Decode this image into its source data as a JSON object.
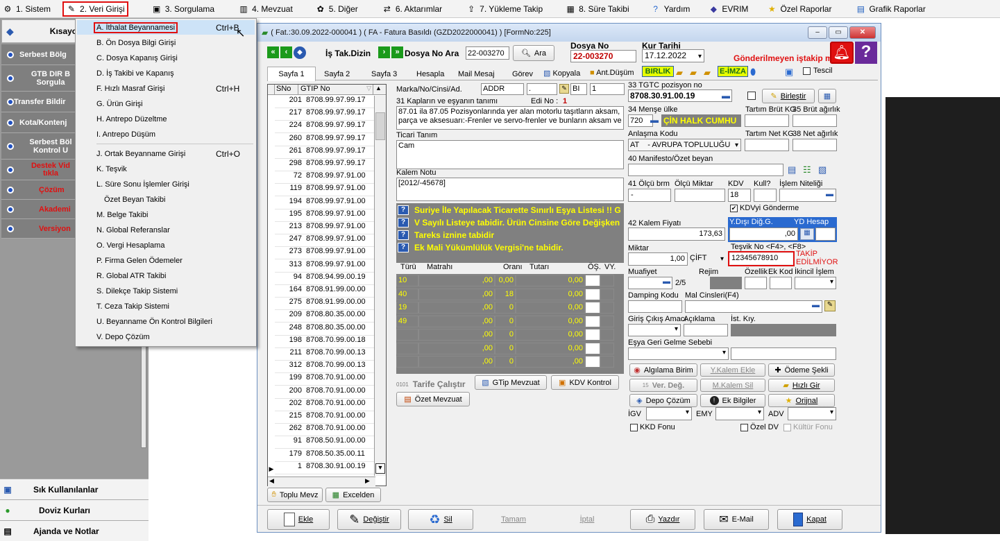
{
  "menubar": {
    "items": [
      {
        "label": "1. Sistem",
        "icon": "system-icon"
      },
      {
        "label": "2. Veri Girişi",
        "icon": "data-entry-icon"
      },
      {
        "label": "3. Sorgulama",
        "icon": "query-icon"
      },
      {
        "label": "4. Mevzuat",
        "icon": "books-icon"
      },
      {
        "label": "5. Diğer",
        "icon": "other-icon"
      },
      {
        "label": "6. Aktarımlar",
        "icon": "transfer-icon"
      },
      {
        "label": "7. Yükleme Takip",
        "icon": "upload-icon"
      },
      {
        "label": "8. Süre Takibi",
        "icon": "calendar-icon"
      },
      {
        "label": "Yardım",
        "icon": "help-icon"
      },
      {
        "label": "EVRIM",
        "icon": "evrim-icon"
      },
      {
        "label": "Özel Raporlar",
        "icon": "star-icon"
      },
      {
        "label": "Grafik Raporlar",
        "icon": "chart-icon"
      }
    ]
  },
  "left_panel": {
    "header": "Kısayo",
    "items": [
      {
        "label": "Serbest Bölg",
        "red": false
      },
      {
        "label": "GTB DIR B\nSorgula",
        "red": false
      },
      {
        "label": "Transfer Bildir",
        "red": false
      },
      {
        "label": "Kota/Kontenj",
        "red": false
      },
      {
        "label": "Serbest Böl\nKontrol U",
        "red": false
      },
      {
        "label": "Destek Vid\ntıkla",
        "red": true
      },
      {
        "label": "Çözüm",
        "red": true
      },
      {
        "label": "Akademi",
        "red": true
      },
      {
        "label": "Versiyon",
        "red": true
      }
    ],
    "bottom": [
      {
        "label": "Sık Kullanılanlar",
        "icon": "favorites-icon"
      },
      {
        "label": "Doviz Kurları",
        "icon": "currency-icon"
      },
      {
        "label": "Ajanda ve Notlar",
        "icon": "notes-icon"
      }
    ]
  },
  "dropdown": {
    "items": [
      {
        "label": "A.  İthalat Beyannamesi",
        "shortcut": "Ctrl+B",
        "highlight": true
      },
      {
        "label": "B.  Ön Dosya Bilgi Girişi",
        "shortcut": ""
      },
      {
        "label": "C.  Dosya Kapanış Girişi",
        "shortcut": ""
      },
      {
        "label": "D.  İş Takibi ve Kapanış",
        "shortcut": ""
      },
      {
        "label": "F.  Hızlı Masraf Girişi",
        "shortcut": "Ctrl+H"
      },
      {
        "label": "G.  Ürün Girişi",
        "shortcut": ""
      },
      {
        "label": "H.  Antrepo Düzeltme",
        "shortcut": ""
      },
      {
        "label": "I.  Antrepo Düşüm",
        "shortcut": ""
      },
      {
        "label": "J.  Ortak Beyanname Girişi",
        "shortcut": "Ctrl+O"
      },
      {
        "label": "K.  Teşvik",
        "shortcut": ""
      },
      {
        "label": "L.  Süre Sonu İşlemler Girişi",
        "shortcut": ""
      },
      {
        "label": "Özet Beyan Takibi",
        "shortcut": ""
      },
      {
        "label": "M.  Belge Takibi",
        "shortcut": ""
      },
      {
        "label": "N.  Global Referanslar",
        "shortcut": ""
      },
      {
        "label": "O. Vergi Hesaplama",
        "shortcut": ""
      },
      {
        "label": "P. Firma Gelen Ödemeler",
        "shortcut": ""
      },
      {
        "label": "R. Global ATR Takibi",
        "shortcut": ""
      },
      {
        "label": "S. Dilekçe Takip Sistemi",
        "shortcut": ""
      },
      {
        "label": "T. Ceza Takip Sistemi",
        "shortcut": ""
      },
      {
        "label": "U. Beyanname Ön Kontrol Bilgileri",
        "shortcut": ""
      },
      {
        "label": "V. Depo Çözüm",
        "shortcut": ""
      }
    ]
  },
  "window": {
    "title": "( Fat.:30.09.2022-000041 ) ( FA  - Fatura Basıldı (GZD2022000041) ) [FormNo:225]",
    "is_takip_label": "İş Tak.Dizin",
    "dosya_ara_label": "Dosya No Ara",
    "dosya_ara_value": "22-003270",
    "ara_button": "Ara",
    "dosya_no_label": "Dosya No",
    "dosya_no_value": "22-003270",
    "kur_tarihi_label": "Kur Tarihi",
    "kur_tarihi_value": "17.12.2022",
    "gonderilmeyen": "Gönderilmeyen iştakip m",
    "tabs": [
      "Sayfa 1",
      "Sayfa 2",
      "Sayfa 3",
      "Hesapla",
      "Mail Mesaj",
      "Görev",
      "Kopyala",
      "Ant.Düşüm"
    ],
    "birlik": "BIRLIK",
    "eimza": "E-İMZA",
    "tescil": "Tescil"
  },
  "gtip_table": {
    "headers": [
      "SNo",
      "GTIP No"
    ],
    "rows": [
      [
        "201",
        "8708.99.97.99.17"
      ],
      [
        "217",
        "8708.99.97.99.17"
      ],
      [
        "224",
        "8708.99.97.99.17"
      ],
      [
        "260",
        "8708.99.97.99.17"
      ],
      [
        "261",
        "8708.99.97.99.17"
      ],
      [
        "298",
        "8708.99.97.99.17"
      ],
      [
        "72",
        "8708.99.97.91.00"
      ],
      [
        "119",
        "8708.99.97.91.00"
      ],
      [
        "194",
        "8708.99.97.91.00"
      ],
      [
        "195",
        "8708.99.97.91.00"
      ],
      [
        "213",
        "8708.99.97.91.00"
      ],
      [
        "247",
        "8708.99.97.91.00"
      ],
      [
        "273",
        "8708.99.97.91.00"
      ],
      [
        "313",
        "8708.99.97.91.00"
      ],
      [
        "94",
        "8708.94.99.00.19"
      ],
      [
        "164",
        "8708.91.99.00.00"
      ],
      [
        "275",
        "8708.91.99.00.00"
      ],
      [
        "209",
        "8708.80.35.00.00"
      ],
      [
        "248",
        "8708.80.35.00.00"
      ],
      [
        "198",
        "8708.70.99.00.18"
      ],
      [
        "211",
        "8708.70.99.00.13"
      ],
      [
        "312",
        "8708.70.99.00.13"
      ],
      [
        "199",
        "8708.70.91.00.00"
      ],
      [
        "200",
        "8708.70.91.00.00"
      ],
      [
        "202",
        "8708.70.91.00.00"
      ],
      [
        "215",
        "8708.70.91.00.00"
      ],
      [
        "262",
        "8708.70.91.00.00"
      ],
      [
        "91",
        "8708.50.91.00.00"
      ],
      [
        "179",
        "8708.50.35.00.11"
      ],
      [
        "1",
        "8708.30.91.00.19"
      ]
    ],
    "toplu_mevz": "Toplu Mevz",
    "excelden": "Excelden"
  },
  "mid": {
    "marka_label": "Marka/No/Cinsi/Ad.",
    "marka_value": "ADDR",
    "bi_value": "BI",
    "one_value": "1",
    "kaplar_label": "31 Kapların ve eşyanın tanımı",
    "edi_no_label": "Edi No :",
    "edi_no_value": "1",
    "description": "87.01 ila 87.05 Pozisyonlarında yer alan motorlu taşıtların aksam, parça ve aksesuarı:-Frenler ve servo-frenler ve bunların aksam ve",
    "ticari_label": "Ticari Tanım",
    "ticari_value": "Cam",
    "kalem_notu_label": "Kalem Notu",
    "kalem_notu_value": "[2012/-45678]",
    "warnings": [
      "Suriye İle Yapılacak Ticarette Sınırlı Eşya Listesi !! G",
      "V Sayılı Listeye tabidir. Ürün Cinsine Göre Değişken",
      "Tareks iznine tabidir",
      "Ek Mali Yükümlülük Vergisi'ne tabidir."
    ],
    "tax_headers": [
      "Türü",
      "Matrahı",
      "Oranı",
      "Tutarı",
      "ÖŞ.",
      "VY."
    ],
    "tax_rows": [
      [
        "10",
        ",00",
        "0,00",
        "0,00"
      ],
      [
        "40",
        ",00",
        "18",
        "0,00"
      ],
      [
        "19",
        ",00",
        "0",
        "0,00"
      ],
      [
        "49",
        ",00",
        "0",
        "0,00"
      ],
      [
        "",
        ",00",
        "0",
        "0,00"
      ],
      [
        "",
        ",00",
        "0",
        "0,00"
      ],
      [
        "",
        ",00",
        "0",
        ",00"
      ]
    ],
    "tarife_calistir": "Tarife Çalıştır",
    "gtip_mevzuat": "GTip Mevzuat",
    "kdv_kontrol": "KDV Kontrol",
    "ozet_mevzuat": "Özet Mevzuat"
  },
  "right": {
    "tgtc_label": "33 TGTC pozisyon no",
    "tgtc_value": "8708.30.91.00.19",
    "birlestir": "Birleştir",
    "mense_label": "34 Menşe ülke",
    "mense_code": "720",
    "mense_name": "ÇİN HALK CUMHU",
    "tartim_brut_label": "Tartım Brüt KG",
    "brut_agirlik_label": "35 Brüt ağırlık",
    "anlasma_label": "Anlaşma Kodu",
    "anlasma_value": "AT    - AVRUPA TOPLULUĞU",
    "tartim_net_label": "Tartım Net KG",
    "net_agirlik_label": "38 Net ağırlık",
    "manifesto_label": "40 Manifesto/Özet beyan",
    "olcu_birim_label": "41 Ölçü brm",
    "olcu_miktar_label": "Ölçü Miktar",
    "kdv_label": "KDV",
    "kull_label": "Kull?",
    "islem_niteligi_label": "İşlem Niteliği",
    "olcu_birim_value": "-",
    "kdv_value": "18",
    "kdv_gonderme": "KDVyi Gönderme",
    "kalem_fiyati_label": "42 Kalem Fiyatı",
    "kalem_fiyati_value": "173,63",
    "ydisi_label": "Y.Dışı Diğ.G.",
    "yd_hesap_label": "YD Hesap",
    "ydisi_value": ",00",
    "miktar_label": "Miktar",
    "miktar_value": "1,00",
    "miktar_unit": "ÇİFT",
    "tesvik_label": "Teşvik No <F4>, <F8>",
    "tesvik_value": "12345678910",
    "takip_text": "TAKİP\nEDİLMİYOR",
    "muafiyet_label": "Muafiyet",
    "rejim_label": "Rejim",
    "ozellik_label": "Özellik",
    "ek_kod_label": "Ek Kod",
    "ikincil_label": "İkincil İşlem",
    "muafiyet_value": "2/5",
    "damping_label": "Damping Kodu",
    "mal_cinsleri_label": "Mal Cinsleri(F4)",
    "giris_label": "Giriş Çıkış Amacı",
    "aciklama_label": "Açıklama",
    "ist_kiy_label": "İst. Kıy.",
    "esya_geri_label": "Eşya Geri Gelme Sebebi",
    "btn_algilama": "Algılama Birim",
    "btn_ykalem": "Y.Kalem Ekle",
    "btn_odeme": "Ödeme Şekli",
    "btn_verdeg": "Ver. Değ.",
    "btn_mkalem": "M.Kalem Sil",
    "btn_hizli": "Hızlı Gir",
    "btn_depo": "Depo Çözüm",
    "btn_ek": "Ek Bilgiler",
    "btn_orjinal": "Orijnal",
    "igv_label": "İGV",
    "emy_label": "EMY",
    "adv_label": "ADV",
    "kkd_fonu": "KKD Fonu",
    "ozel_dv": "Özel DV",
    "kultur_fonu": "Kültür Fonu"
  },
  "bottom_bar": {
    "ekle": "Ekle",
    "degistir": "Değiştir",
    "sil": "Sil",
    "tamam": "Tamam",
    "iptal": "İptal",
    "yazdir": "Yazdır",
    "email": "E-Mail",
    "kapat": "Kapat"
  },
  "colors": {
    "highlight_red": "#e01010",
    "left_panel_bg": "#9a9a9a",
    "left_item_bg": "#7f7f7f",
    "warning_bg": "#808080",
    "warning_text": "#ffff00",
    "tax_text": "#ffff00",
    "dark_right": "#1e1e1e",
    "nav_green": "#1b9a1b",
    "birlik_bg": "#e6ff00"
  }
}
